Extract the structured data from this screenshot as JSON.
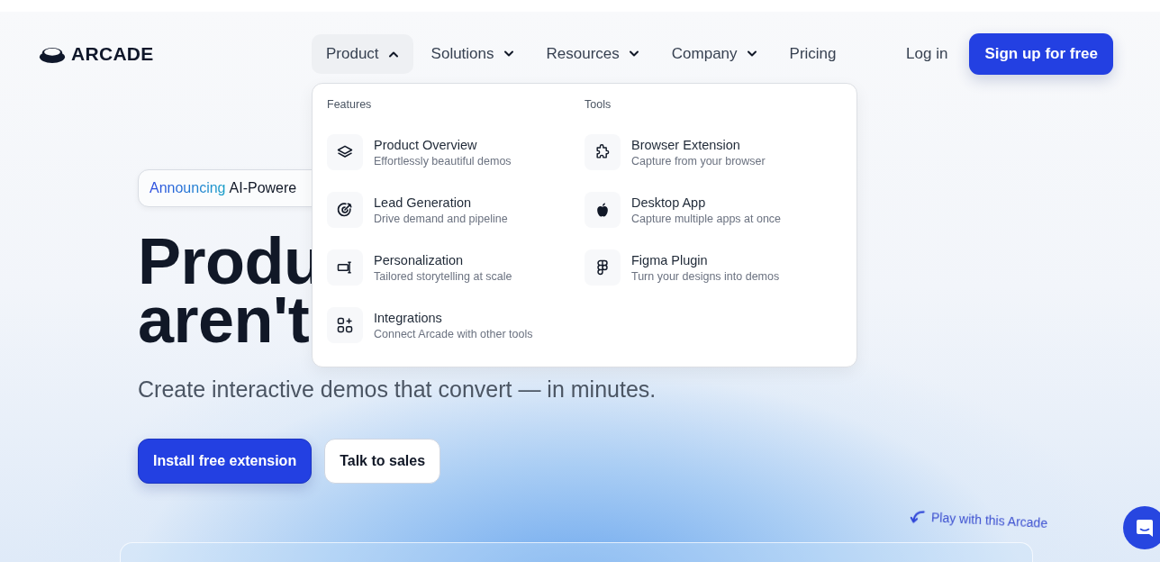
{
  "logo": {
    "text": "ARCADE"
  },
  "nav": {
    "items": [
      {
        "label": "Product",
        "kind": "dropdown",
        "expanded": true
      },
      {
        "label": "Solutions",
        "kind": "dropdown",
        "expanded": false
      },
      {
        "label": "Resources",
        "kind": "dropdown",
        "expanded": false
      },
      {
        "label": "Company",
        "kind": "dropdown",
        "expanded": false
      },
      {
        "label": "Pricing",
        "kind": "link",
        "expanded": false
      }
    ],
    "login": "Log in",
    "signup": "Sign up for free"
  },
  "dropdown": {
    "sections": [
      {
        "title": "Features",
        "items": [
          {
            "title": "Product Overview",
            "subtitle": "Effortlessly beautiful demos"
          },
          {
            "title": "Lead Generation",
            "subtitle": "Drive demand and pipeline"
          },
          {
            "title": "Personalization",
            "subtitle": "Tailored storytelling at scale"
          },
          {
            "title": "Integrations",
            "subtitle": "Connect Arcade with other tools"
          }
        ]
      },
      {
        "title": "Tools",
        "items": [
          {
            "title": "Browser Extension",
            "subtitle": "Capture from your browser"
          },
          {
            "title": "Desktop App",
            "subtitle": "Capture multiple apps at once"
          },
          {
            "title": "Figma Plugin",
            "subtitle": "Turn your designs into demos"
          }
        ]
      }
    ]
  },
  "hero": {
    "badge": {
      "highlight": "Announcing",
      "text": "AI-Powere"
    },
    "headline": [
      "Produ",
      "aren't"
    ],
    "subtitle": "Create interactive demos that convert — in minutes.",
    "buttons": [
      {
        "label": "Install free extension",
        "kind": "primary"
      },
      {
        "label": "Talk to sales",
        "kind": "secondary"
      }
    ],
    "play_hint": "Play with this Arcade"
  }
}
